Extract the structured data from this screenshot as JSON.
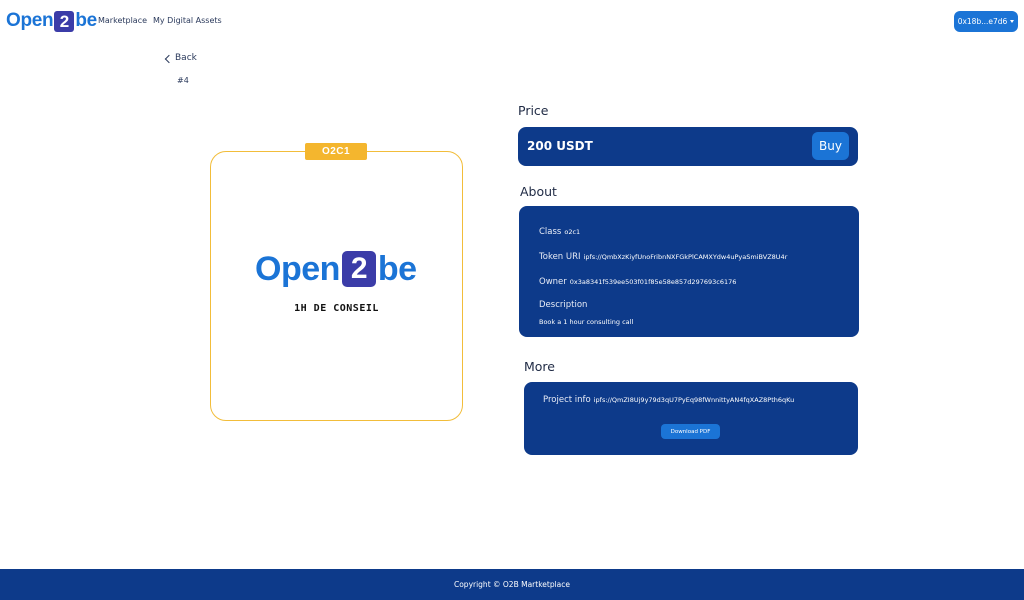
{
  "navbar": {
    "logo": {
      "left": "Open",
      "middle": "2",
      "right": "be"
    },
    "links": [
      "Marketplace",
      "My Digital Assets"
    ],
    "wallet_label": "0x18b...e7d6"
  },
  "nav": {
    "back_label": "Back",
    "token_id": "#4"
  },
  "card": {
    "badge": "O2C1",
    "logo": {
      "left": "Open",
      "middle": "2",
      "right": "be"
    },
    "caption": "1H DE CONSEIL"
  },
  "price": {
    "title": "Price",
    "value": "200 USDT",
    "buy_label": "Buy"
  },
  "about": {
    "title": "About",
    "class_label": "Class",
    "class_value": "o2c1",
    "token_uri_label": "Token URI",
    "token_uri_value": "ipfs://QmbXzKiyfUnoFribnNXFGkPlCAMXYdw4uPyaSmiBVZ8U4r",
    "owner_label": "Owner",
    "owner_value": "0x3a8341f539ee503f01f85e58e857d297693c6176",
    "description_label": "Description",
    "description_value": "Book a 1 hour consulting call"
  },
  "more": {
    "title": "More",
    "project_info_label": "Project info",
    "project_info_value": "ipfs://QmZI8Uj9y79d3qU7PyEq98fWnnittyAN4fqXAZ8Pth6qKu",
    "download_label": "Download PDF"
  },
  "footer": {
    "text": "Copyright © O2B Martketplace"
  },
  "colors": {
    "primary": "#1b74d6",
    "panel": "#0d3a8a",
    "accent": "#f4b62e",
    "logo_box": "#3b3ca8"
  }
}
